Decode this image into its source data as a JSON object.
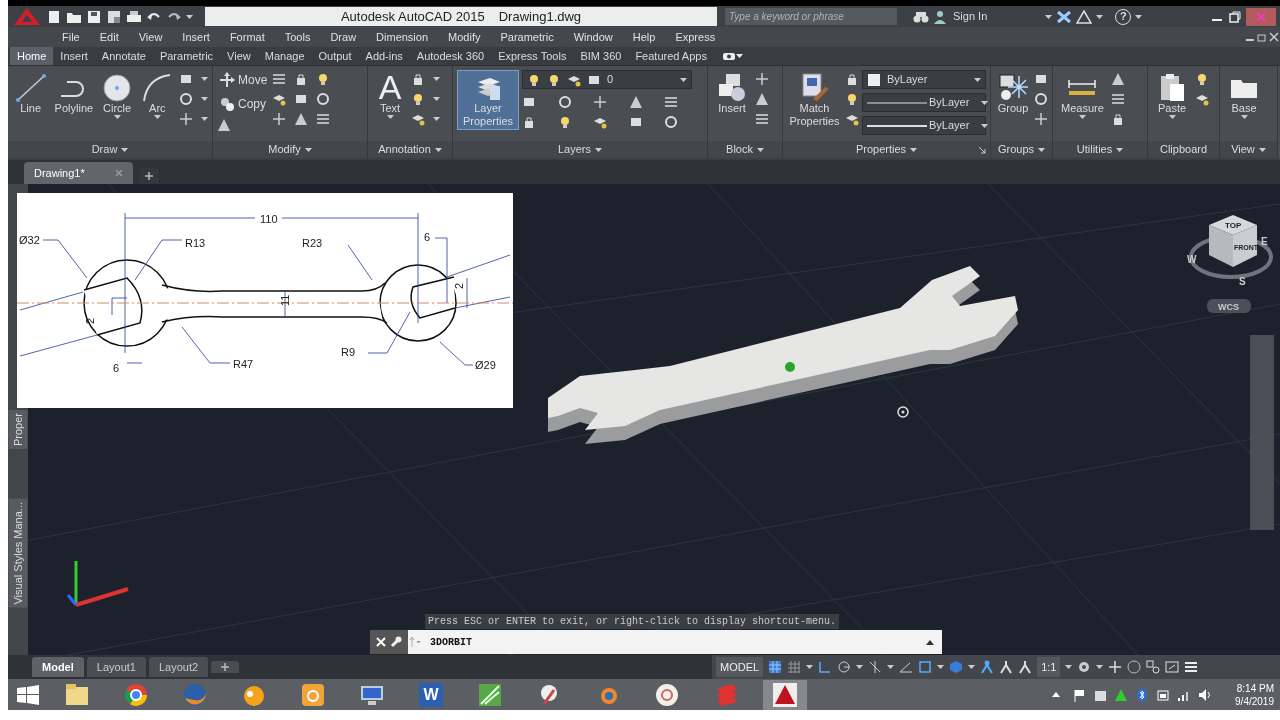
{
  "title_bar": {
    "app_title": "Autodesk AutoCAD 2015",
    "file_name": "Drawing1.dwg",
    "search": {
      "placeholder": "Type a keyword or phrase"
    },
    "sign_in": "Sign In",
    "help": "?"
  },
  "menu_bar": [
    "File",
    "Edit",
    "View",
    "Insert",
    "Format",
    "Tools",
    "Draw",
    "Dimension",
    "Modify",
    "Parametric",
    "Window",
    "Help",
    "Express"
  ],
  "ribbon_tabs": [
    {
      "label": "Home",
      "selected": true
    },
    {
      "label": "Insert",
      "selected": false
    },
    {
      "label": "Annotate",
      "selected": false
    },
    {
      "label": "Parametric",
      "selected": false
    },
    {
      "label": "View",
      "selected": false
    },
    {
      "label": "Manage",
      "selected": false
    },
    {
      "label": "Output",
      "selected": false
    },
    {
      "label": "Add-ins",
      "selected": false
    },
    {
      "label": "Autodesk 360",
      "selected": false
    },
    {
      "label": "Express Tools",
      "selected": false
    },
    {
      "label": "BIM 360",
      "selected": false
    },
    {
      "label": "Featured Apps",
      "selected": false
    }
  ],
  "ribbon_panels": [
    {
      "title": "Draw",
      "has_menu": true,
      "tools": [
        {
          "label": "Line",
          "highlighted": false,
          "dropdown": false
        },
        {
          "label": "Polyline",
          "highlighted": false,
          "dropdown": false
        },
        {
          "label": "Circle",
          "highlighted": false,
          "dropdown": true
        },
        {
          "label": "Arc",
          "highlighted": false,
          "dropdown": true
        }
      ]
    },
    {
      "title": "Modify",
      "has_menu": true,
      "small_tools": [
        {
          "label": "Move"
        },
        {
          "label": "Copy"
        }
      ]
    },
    {
      "title": "Annotation",
      "has_menu": true,
      "tools": [
        {
          "label": "Text",
          "glyph": "A",
          "highlighted": false,
          "dropdown": true
        }
      ]
    },
    {
      "title": "Layers",
      "has_menu": true,
      "tools": [
        {
          "label": "Layer Properties",
          "highlighted": true,
          "dropdown": false
        }
      ],
      "dropdowns": [
        {
          "kind": "layer",
          "value": "0"
        }
      ]
    },
    {
      "title": "Block",
      "has_menu": true,
      "tools": [
        {
          "label": "Insert",
          "highlighted": false,
          "dropdown": false
        }
      ]
    },
    {
      "title": "Properties",
      "has_menu": true,
      "tools": [
        {
          "label": "Match Properties",
          "highlighted": false,
          "dropdown": false
        }
      ],
      "dropdowns": [
        {
          "kind": "color",
          "value": "ByLayer"
        },
        {
          "kind": "linetype",
          "value": "ByLayer"
        },
        {
          "kind": "lineweight",
          "value": "ByLayer"
        }
      ]
    },
    {
      "title": "Groups",
      "has_menu": true,
      "tools": [
        {
          "label": "Group",
          "highlighted": false,
          "dropdown": false
        }
      ]
    },
    {
      "title": "Utilities",
      "has_menu": true,
      "tools": [
        {
          "label": "Measure",
          "highlighted": false,
          "dropdown": true
        }
      ]
    },
    {
      "title": "Clipboard",
      "has_menu": false,
      "tools": [
        {
          "label": "Paste",
          "highlighted": false,
          "dropdown": true
        }
      ]
    },
    {
      "title": "View",
      "has_menu": true,
      "tools": [
        {
          "label": "Base",
          "highlighted": false,
          "dropdown": true
        }
      ]
    }
  ],
  "file_tabs": [
    {
      "label": "Drawing1*",
      "selected": true
    }
  ],
  "palettes": [
    {
      "label": "Proper"
    },
    {
      "label": "Visual Styles Mana..."
    }
  ],
  "reference_drawing": {
    "labels": [
      "Ø32",
      "R13",
      "110",
      "R23",
      "6",
      "2",
      "11",
      "2",
      "6",
      "R47",
      "R9",
      "Ø29"
    ]
  },
  "view_cube": {
    "top": "TOP",
    "front": "FRONT",
    "west": "W",
    "east": "E",
    "south": "S",
    "ucs": "WCS"
  },
  "command_line": {
    "message": "Press ESC or ENTER to exit, or right-click to display shortcut-menu.",
    "command": "3DORBIT"
  },
  "layout_tabs": [
    {
      "label": "Model",
      "selected": true
    },
    {
      "label": "Layout1",
      "selected": false
    },
    {
      "label": "Layout2",
      "selected": false
    }
  ],
  "status_bar": {
    "space": "MODEL",
    "scale": "1:1"
  },
  "taskbar": {
    "apps": [
      {
        "active": false
      },
      {
        "active": false
      },
      {
        "active": false
      },
      {
        "active": false
      },
      {
        "active": false
      },
      {
        "active": false
      },
      {
        "active": false,
        "glyph": "W"
      },
      {
        "active": false
      },
      {
        "active": false
      },
      {
        "active": false
      },
      {
        "active": false
      },
      {
        "active": false
      },
      {
        "active": true
      }
    ],
    "time": "8:14 PM",
    "date": "9/4/2019"
  }
}
